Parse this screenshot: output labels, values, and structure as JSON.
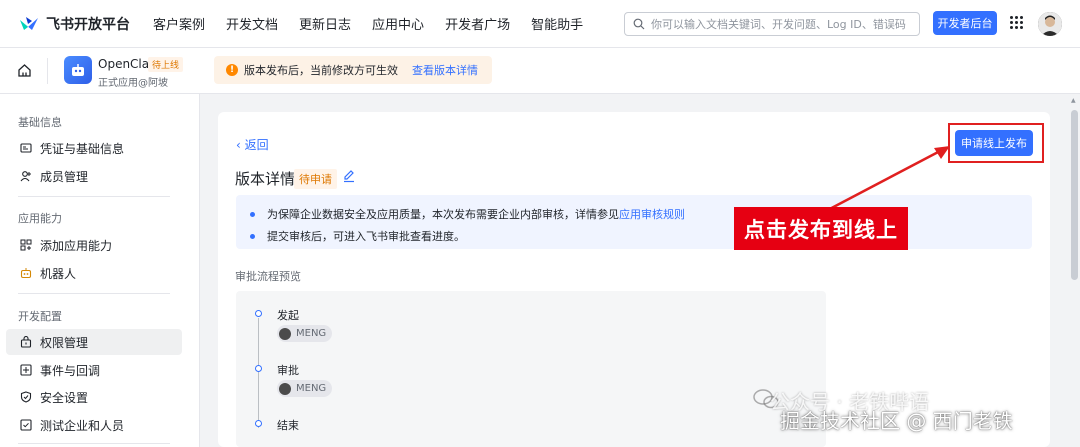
{
  "topnav": {
    "logo_text": "飞书开放平台",
    "items": [
      "客户案例",
      "开发文档",
      "更新日志",
      "应用中心",
      "开发者广场",
      "智能助手"
    ],
    "search_placeholder": "你可以输入文档关键词、开发问题、Log ID、错误码",
    "dev_button": "开发者后台"
  },
  "appbar": {
    "app_name": "OpenClaw",
    "app_badge": "待上线",
    "app_sub": "正式应用@阿坡",
    "notice_text": "版本发布后，当前修改方可生效",
    "notice_link": "查看版本详情"
  },
  "sidebar": {
    "groups": [
      "基础信息",
      "应用能力",
      "开发配置"
    ],
    "items": [
      "凭证与基础信息",
      "成员管理",
      "添加应用能力",
      "机器人",
      "权限管理",
      "事件与回调",
      "安全设置",
      "测试企业和人员"
    ]
  },
  "main": {
    "back_label": "返回",
    "title": "版本详情",
    "status": "待申请",
    "submit_button": "申请线上发布",
    "info_line1_prefix": "为保障企业数据安全及应用质量，本次发布需要企业内部审核，详情参见",
    "info_line1_link": "应用审核规则",
    "info_line2": "提交审核后，可进入飞书审批查看进度。",
    "section_label": "审批流程预览",
    "steps": [
      "发起",
      "审批",
      "结束"
    ],
    "user": "MENG"
  },
  "annotation": {
    "text": "点击发布到线上",
    "color": "#e60012"
  },
  "watermark": {
    "line1": "公众号 · 老铁哔语",
    "line2": "掘金技术社区 @ 西门老铁"
  },
  "colors": {
    "primary": "#3370ff",
    "warning": "#de7802",
    "annotation_red": "#e60012"
  }
}
